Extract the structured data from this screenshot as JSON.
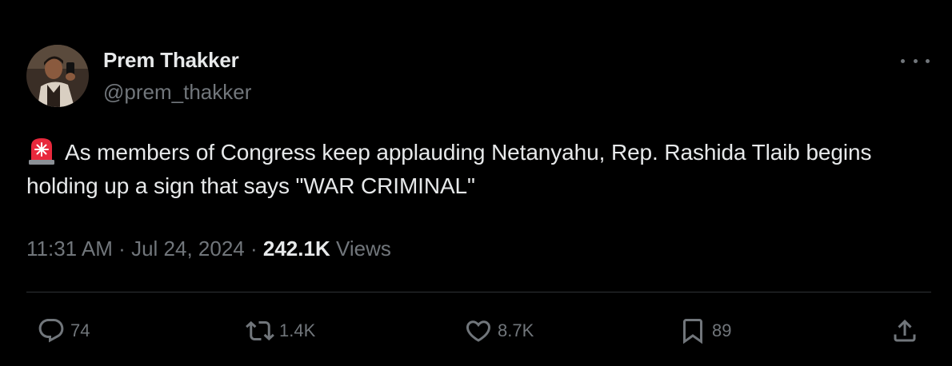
{
  "author": {
    "name": "Prem Thakker",
    "handle": "@prem_thakker"
  },
  "tweet": {
    "emoji": "siren-icon",
    "text": "As members of Congress keep applauding Netanyahu, Rep. Rashida Tlaib begins holding up a sign that says \"WAR CRIMINAL\"",
    "time": "11:31 AM",
    "separator": "·",
    "date": "Jul 24, 2024",
    "views_count": "242.1K",
    "views_label": "Views"
  },
  "actions": {
    "replies": "74",
    "reposts": "1.4K",
    "likes": "8.7K",
    "bookmarks": "89"
  },
  "colors": {
    "background": "#000000",
    "primary_text": "#e7e9ea",
    "secondary_text": "#71767b",
    "divider": "#2f3336"
  },
  "icons": {
    "more": "more-horizontal-icon",
    "reply": "reply-icon",
    "repost": "repost-icon",
    "like": "like-icon",
    "bookmark": "bookmark-icon",
    "share": "share-icon"
  }
}
